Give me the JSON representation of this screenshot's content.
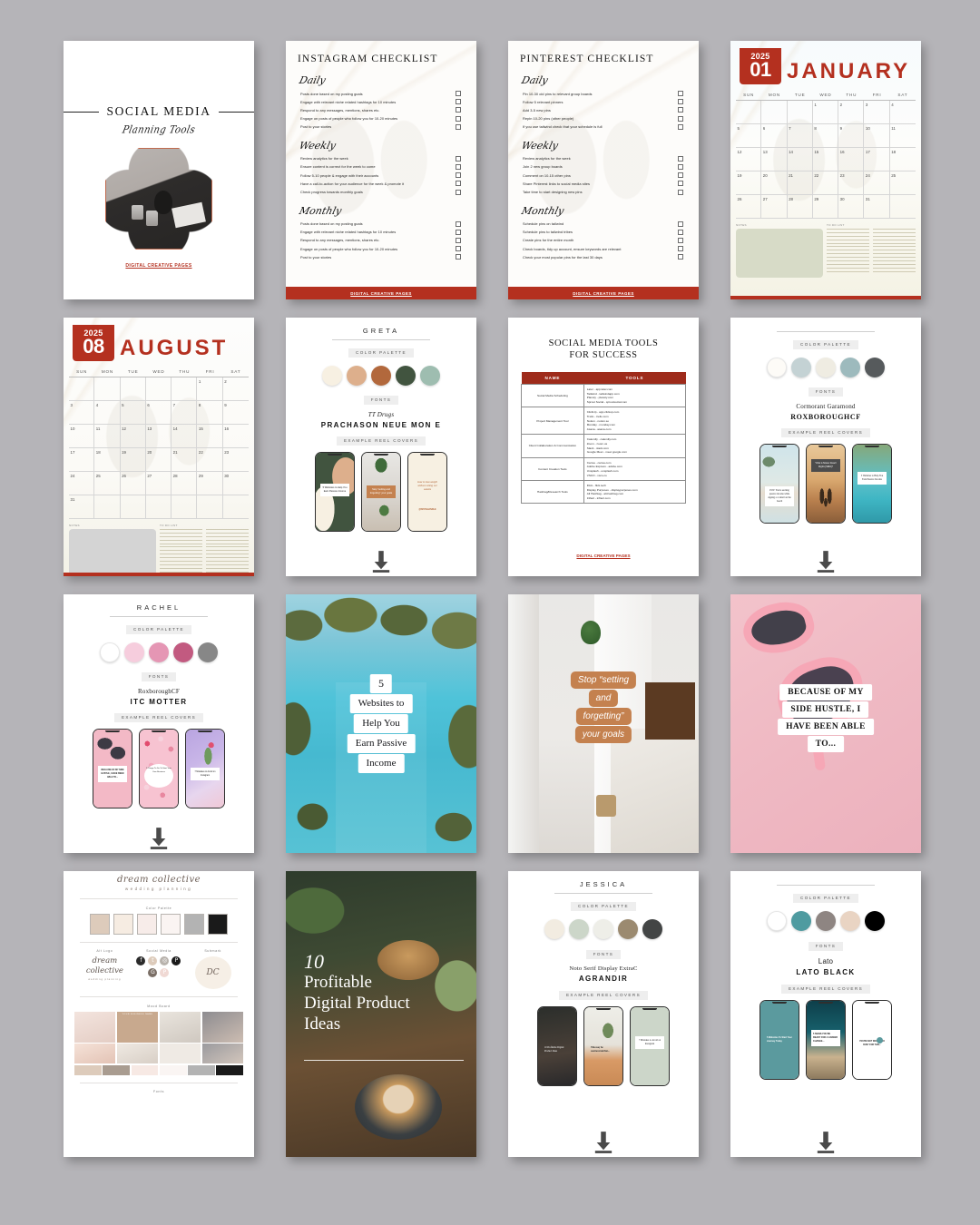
{
  "background_color": "#b5b4b8",
  "brand_red": "#b4301f",
  "footer_text": "DIGITAL CREATIVE PAGES",
  "cards": {
    "cover": {
      "title": "SOCIAL MEDIA",
      "subtitle": "Planning Tools",
      "footer": "DIGITAL CREATIVE PAGES"
    },
    "instagram_checklist": {
      "title": "INSTAGRAM CHECKLIST",
      "sections": [
        {
          "heading": "Daily",
          "items": [
            "Posts done based on my posting goals",
            "Engage with relevant niche related hashtags for 10 minutes",
            "Respond to any messages, mentions, shares etc.",
            "Engage on posts of people who follow you for 10-20 minutes",
            "Post to your stories"
          ]
        },
        {
          "heading": "Weekly",
          "items": [
            "Review analytics for the week",
            "Ensure content is correct for the week to come",
            "Follow 5-10 people & engage with their accounts",
            "Have a call-to-action for your audience for the week & promote it",
            "Check progress towards monthly goals"
          ]
        },
        {
          "heading": "Monthly",
          "items": [
            "Posts done based on my posting goals",
            "Engage with relevant niche related hashtags for 10 minutes",
            "Respond to any messages, mentions, shares etc.",
            "Engage on posts of people who follow you for 10-20 minutes",
            "Post to your stories"
          ]
        }
      ],
      "footer": "DIGITAL CREATIVE PAGES"
    },
    "pinterest_checklist": {
      "title": "PINTEREST CHECKLIST",
      "sections": [
        {
          "heading": "Daily",
          "items": [
            "Pin 10-30 old pins to relevant group boards",
            "Follow 5 relevant pinners",
            "Add 3-5 new pins",
            "Repin 10-20 pins (other people)",
            "If you use tailwind check that your schedule is full"
          ]
        },
        {
          "heading": "Weekly",
          "items": [
            "Review analytics for the week",
            "Join 2 new group boards",
            "Comment on 10-15 other pins",
            "Share Pinterest links to social media sites",
            "Take time to start designing new pins"
          ]
        },
        {
          "heading": "Monthly",
          "items": [
            "Schedule pins on tailwind",
            "Schedule pins to tailwind tribes",
            "Create pins for the entire month",
            "Check boards, tidy up account, ensure keywords are relevant",
            "Check your most popular pins for the last 30 days"
          ]
        }
      ],
      "footer": "DIGITAL CREATIVE PAGES"
    },
    "calendar_january": {
      "year": "2025",
      "number": "01",
      "month": "JANUARY",
      "dows": [
        "SUN",
        "MON",
        "TUE",
        "WED",
        "THU",
        "FRI",
        "SAT"
      ],
      "leading_blanks": 3,
      "days": 31,
      "notes_label": "NOTES",
      "todo_label": "TO DO LIST"
    },
    "calendar_august": {
      "year": "2025",
      "number": "08",
      "month": "AUGUST",
      "dows": [
        "SUN",
        "MON",
        "TUE",
        "WED",
        "THU",
        "FRI",
        "SAT"
      ],
      "leading_blanks": 5,
      "days": 31,
      "notes_label": "NOTES",
      "todo_label": "TO DO LIST"
    },
    "brand_greta": {
      "name": "GRETA",
      "palette_label": "COLOR PALETTE",
      "palette": [
        "#f7f0e2",
        "#ddaf8c",
        "#b2683c",
        "#41543f",
        "#9ebdb0"
      ],
      "fonts_label": "FONTS",
      "font_primary": "TT Drugs",
      "font_secondary": "PRACHASON NEUE MON E",
      "covers_label": "EXAMPLE REEL COVERS",
      "covers": [
        "5 Websites to Help You Earn Passive Income",
        "Stop \"setting and forgetting\" your goals",
        "How to lose weight without cutting out sweets"
      ],
      "handle": "@INSTAHANDLE"
    },
    "tools_table": {
      "title_line1": "SOCIAL MEDIA TOOLS",
      "title_line2": "FOR SUCCESS",
      "columns": [
        "NAME",
        "TOOLS"
      ],
      "rows": [
        {
          "name": "Social Media Scheduling",
          "tools": "Later - app.later.com\nTailwind - tailwindapp.com\nPlanoly - planoly.com\nSprout Social - sproutsocial.com"
        },
        {
          "name": "Project Management Tool",
          "tools": "ClickUp - app.clickup.com\nTrello - trello.com\nNotion - notion.so\nMonday - monday.com\nAsana - asana.com"
        },
        {
          "name": "Client Collaboration & Communication",
          "tools": "Calendly - calendly.com\nZoom - zoom.us\nSlack - slack.com\nGoogle Meet - meet.google.com"
        },
        {
          "name": "Content Creation Tools",
          "tools": "Canva - canva.com\nAdobe Express - adobe.com\nUnsplash - unsplash.com\nVSCO - vsco.co"
        },
        {
          "name": "Hashtag/Research Tools",
          "tools": "Flick - flick.tech\nDisplay Purposes - displaypurposes.com\nAll Hashtag - all-hashtag.com\nInflact - inflact.com"
        }
      ],
      "footer": "DIGITAL CREATIVE PAGES"
    },
    "brand_roxborough": {
      "name": "",
      "palette_label": "COLOR PALETTE",
      "palette": [
        "#fdfbf7",
        "#c4d2d4",
        "#efece2",
        "#9dbabd",
        "#565a5c"
      ],
      "fonts_label": "FONTS",
      "font_primary": "Cormorant Garamond",
      "font_secondary": "ROXBOROUGHCF",
      "covers_label": "EXAMPLE REEL COVERS",
      "covers": [
        "POV: You're earning passive income while sipping a cocktail on the beach",
        "What is Master Resell Rights (MRR)?",
        "5 Websites to Help You Earn Passive Income"
      ]
    },
    "brand_rachel": {
      "name": "RACHEL",
      "palette_label": "COLOR PALETTE",
      "palette": [
        "#ffffff",
        "#f6cddd",
        "#e596b4",
        "#c25a80",
        "#878787"
      ],
      "fonts_label": "FONTS",
      "font_primary": "RoxboroughCF",
      "font_secondary": "ITC MOTTER",
      "covers_label": "EXAMPLE REEL COVERS",
      "covers": [
        "BECAUSE OF MY SIDE HUSTLE, I HAVE BEEN ABLE TO...",
        "5 Things To Do To Start Your Own Business",
        "7 Mistakes to Avoid on Instagram"
      ]
    },
    "photo_websites": {
      "lines": [
        "5",
        "Websites to",
        "Help You",
        "Earn Passive",
        "Income"
      ]
    },
    "photo_goals": {
      "lines": [
        "Stop “setting",
        "and",
        "forgetting”",
        "your goals"
      ]
    },
    "photo_hustle": {
      "lines": [
        "BECAUSE OF MY",
        "SIDE HUSTLE, I",
        "HAVE BEEN ABLE",
        "TO..."
      ]
    },
    "photo_products": {
      "lines": [
        "10",
        "Profitable",
        "Digital Product",
        "Ideas"
      ]
    },
    "dream_collective": {
      "logo": "dream collective",
      "logo_sub": "wedding planning",
      "monogram": "DC",
      "palette_label": "Color Palette",
      "palette": [
        "#ddcbbb",
        "#f6ece2",
        "#f7ece9",
        "#faf4f2",
        "#b3b3b3",
        "#1a1a1a"
      ],
      "alt_logo_label": "Alt Logo",
      "alt_logo": "dream collective",
      "alt_logo_sub": "wedding planning",
      "social_label": "Social Media",
      "social_icons": [
        "facebook-icon",
        "twitter-icon",
        "instagram-icon",
        "pinterest-icon",
        "googleplus-icon",
        "pinterest-alt-icon"
      ],
      "submark_label": "Submark",
      "moodboard_label": "Mood Board",
      "moodboard_tag": "YOUR BUSINESS NAME",
      "strip": [
        "#ddcbbb",
        "#a99c90",
        "#f7e9e4",
        "#faf5f3",
        "#b3b3b3",
        "#1a1a1a"
      ],
      "fonts_label": "Fonts"
    },
    "brand_jessica": {
      "name": "JESSICA",
      "palette_label": "COLOR PALETTE",
      "palette": [
        "#f2ece1",
        "#ccd6c9",
        "#eeeee8",
        "#9b8a70",
        "#434545"
      ],
      "fonts_label": "FONTS",
      "font_primary": "Noto Serif Display ExtraC",
      "font_secondary": "AGRANDIR",
      "covers_label": "EXAMPLE REEL COVERS",
      "covers": [
        "10 Profitable Digital Product Ideas",
        "This may be controversial but...",
        "7 Mistakes to Avoid on Instagram"
      ]
    },
    "brand_lato": {
      "name": "",
      "palette_label": "COLOR PALETTE",
      "palette": [
        "#ffffff",
        "#4f9ba0",
        "#8e8582",
        "#e9d4c3",
        "#000000"
      ],
      "fonts_label": "FONTS",
      "font_primary": "Lato",
      "font_secondary": "LATO BLACK",
      "covers_label": "EXAMPLE REEL COVERS",
      "covers": [
        "5 Websites To Start Your Journey Today",
        "5 SIGNS YOU'RE READY FOR A CAREER CHANGE...",
        "YOU'RE NOT DOING TOO BUSY FOR THIS..."
      ]
    }
  }
}
